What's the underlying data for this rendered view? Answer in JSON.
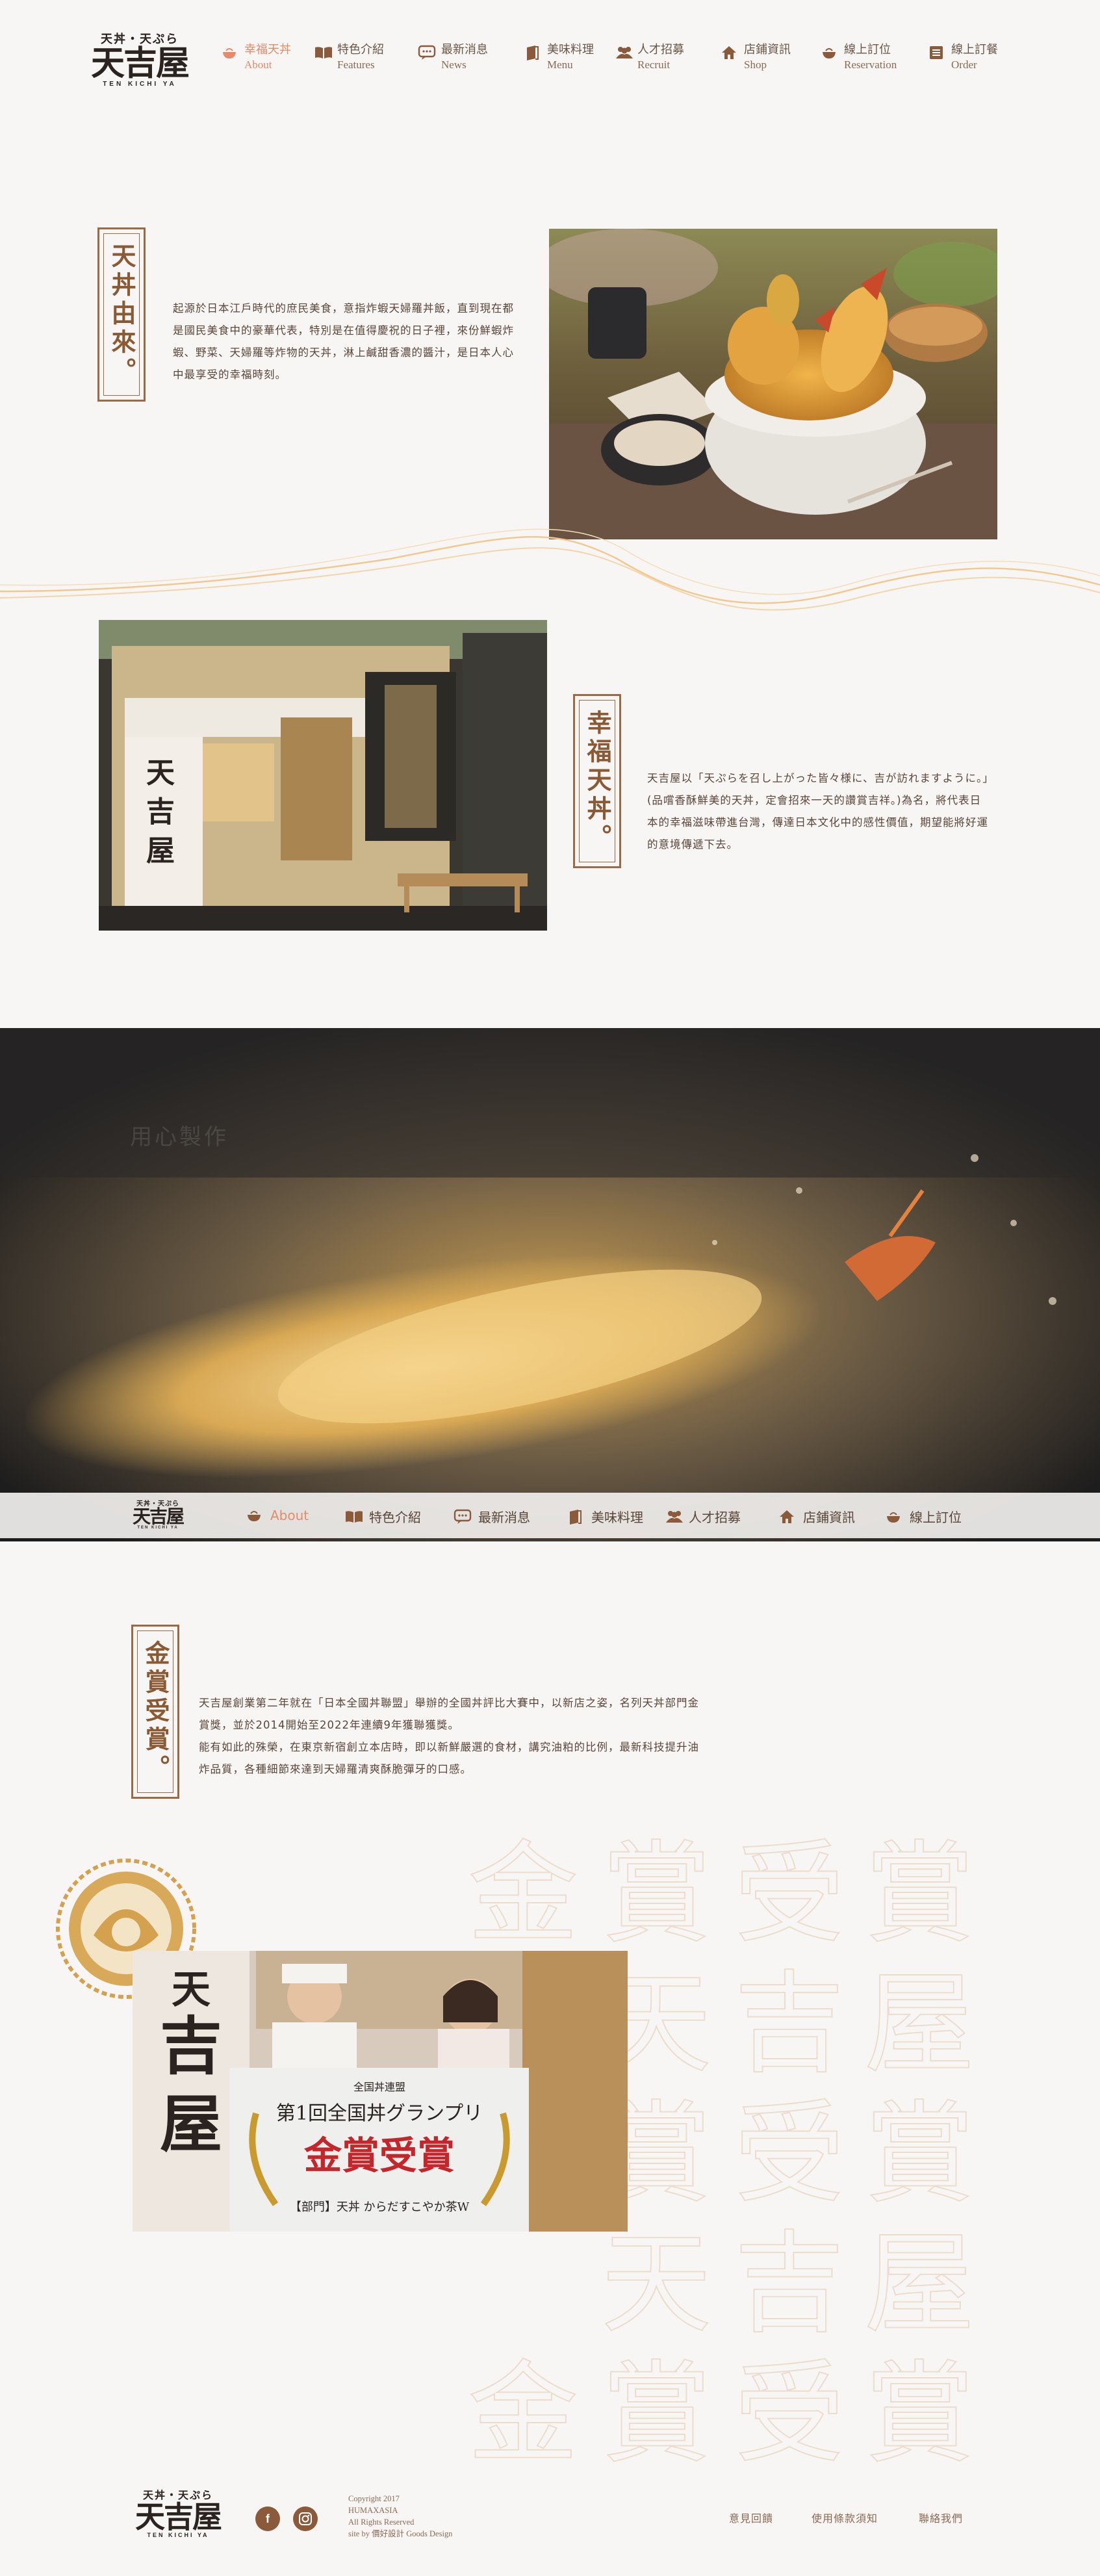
{
  "logo": {
    "sub": "天丼・天ぷら",
    "main": "天吉屋",
    "roman": "TEN KICHI YA"
  },
  "nav": [
    {
      "zh": "幸福天丼",
      "en": "About",
      "icon": "bowl-icon",
      "active": true
    },
    {
      "zh": "特色介紹",
      "en": "Features",
      "icon": "book-icon"
    },
    {
      "zh": "最新消息",
      "en": "News",
      "icon": "chat-icon"
    },
    {
      "zh": "美味料理",
      "en": "Menu",
      "icon": "menu-book-icon"
    },
    {
      "zh": "人才招募",
      "en": "Recruit",
      "icon": "people-icon"
    },
    {
      "zh": "店鋪資訊",
      "en": "Shop",
      "icon": "home-icon"
    },
    {
      "zh": "線上訂位",
      "en": "Reservation",
      "icon": "bowl-icon"
    },
    {
      "zh": "線上訂餐",
      "en": "Order",
      "icon": "list-icon"
    }
  ],
  "sections": {
    "origin": {
      "title": "天丼由來。",
      "text": "起源於日本江戶時代的庶民美食，意指炸蝦天婦羅丼飯，直到現在都是國民美食中的豪華代表，特別是在值得慶祝的日子裡，來份鮮蝦炸蝦、野菜、天婦羅等炸物的天丼，淋上鹹甜香濃的醬汁，是日本人心中最享受的幸福時刻。"
    },
    "happy": {
      "title": "幸福天丼。",
      "text": "天吉屋以「天ぷらを召し上がった皆々様に、吉が訪れますように。」(品嚐香酥鮮美的天丼，定會招來一天的讚賞吉祥。)為名，將代表日本的幸福滋味帶進台灣，傳達日本文化中的感性價值，期望能將好運的意境傳遞下去。"
    },
    "banner": {
      "faded_title": "用心製作"
    },
    "award": {
      "title": "金賞受賞。",
      "text_1": "天吉屋創業第二年就在「日本全國丼聯盟」舉辦的全國丼評比大賽中，以新店之姿，名列天丼部門金賞獎，並於2014開始至2022年連續9年獲聯獲獎。",
      "text_2": "能有如此的殊榮，在東京新宿創立本店時，即以新鮮嚴選的食材，講究油粕的比例，最新科技提升油炸品質，各種細節來達到天婦羅清爽酥脆彈牙的口感。",
      "watermark": [
        "金",
        "賞",
        "受",
        "賞",
        "天",
        "吉",
        "屋",
        "賞",
        "受",
        "賞",
        "天",
        "吉",
        "屋",
        "金",
        "賞",
        "受",
        "賞"
      ],
      "banner_top": "全国丼連盟",
      "banner_mid": "第1回全国丼グランプリ",
      "banner_main": "金賞受賞",
      "banner_bottom": "【部門】天丼 からだすこやか茶W"
    }
  },
  "nav2": [
    {
      "label": "About",
      "icon": "bowl-icon",
      "active": true
    },
    {
      "label": "特色介紹",
      "icon": "book-icon"
    },
    {
      "label": "最新消息",
      "icon": "chat-icon"
    },
    {
      "label": "美味料理",
      "icon": "menu-book-icon"
    },
    {
      "label": "人才招募",
      "icon": "people-icon"
    },
    {
      "label": "店鋪資訊",
      "icon": "home-icon"
    },
    {
      "label": "線上訂位",
      "icon": "bowl-icon"
    }
  ],
  "footer": {
    "copyright_1": "Copyright 2017",
    "copyright_2": "HUMAXASIA",
    "copyright_3": "All Rights Reserved",
    "copyright_4": "site by 價好設計 Goods Design",
    "facebook": "f",
    "links": [
      "意見回饋",
      "使用條款須知",
      "聯絡我們"
    ]
  },
  "colors": {
    "accent": "#e58a6a",
    "brown": "#8a5a3a",
    "background": "#f7f6f5"
  }
}
